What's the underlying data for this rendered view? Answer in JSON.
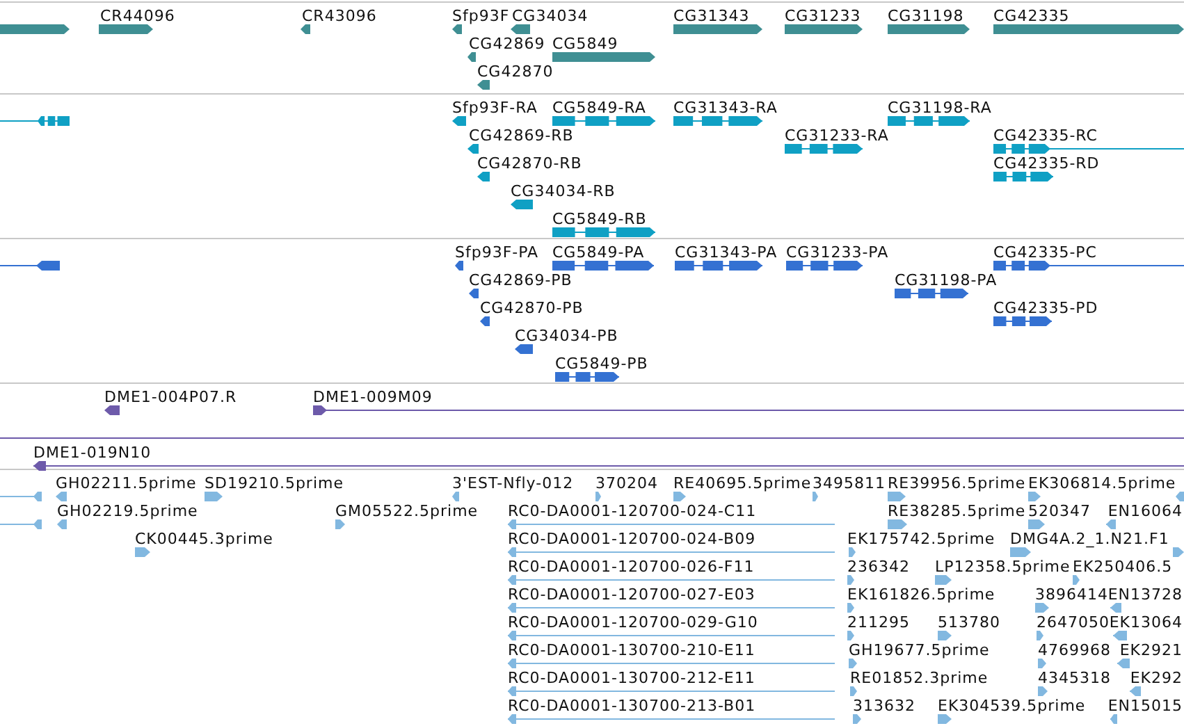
{
  "tracks": [
    {
      "kind": "gene",
      "color": "#3f8f93",
      "features": [
        {
          "reverse": false
        },
        {
          "label": "CR44096",
          "reverse": false
        },
        {
          "label": "CR43096",
          "reverse": true
        },
        {
          "label": "Sfp93F",
          "reverse": true
        },
        {
          "label": "CG34034",
          "reverse": true
        },
        {
          "label": "CG31343",
          "reverse": false
        },
        {
          "label": "CG31233",
          "reverse": false
        },
        {
          "label": "CG31198",
          "reverse": false
        },
        {
          "label": "CG42335",
          "reverse": false
        },
        {
          "label": "CG42869",
          "reverse": true
        },
        {
          "label": "CG5849",
          "reverse": false
        },
        {
          "label": "CG42870",
          "reverse": true
        }
      ]
    },
    {
      "kind": "transcript",
      "color": "#0fa0c4",
      "features": [
        {
          "reverse": true
        },
        {
          "label": "Sfp93F-RA",
          "reverse": true
        },
        {
          "label": "CG5849-RA",
          "reverse": false
        },
        {
          "label": "CG31343-RA",
          "reverse": false
        },
        {
          "label": "CG31198-RA",
          "reverse": false
        },
        {
          "label": "CG42869-RB",
          "reverse": true
        },
        {
          "label": "CG31233-RA",
          "reverse": false
        },
        {
          "label": "CG42335-RC",
          "reverse": false
        },
        {
          "label": "CG42870-RB",
          "reverse": true
        },
        {
          "label": "CG42335-RD",
          "reverse": false
        },
        {
          "label": "CG34034-RB",
          "reverse": true
        },
        {
          "label": "CG5849-RB",
          "reverse": false
        }
      ]
    },
    {
      "kind": "transcript",
      "color": "#3471d2",
      "features": [
        {
          "reverse": true
        },
        {
          "label": "Sfp93F-PA",
          "reverse": true
        },
        {
          "label": "CG5849-PA",
          "reverse": false
        },
        {
          "label": "CG31343-PA",
          "reverse": false
        },
        {
          "label": "CG31233-PA",
          "reverse": false
        },
        {
          "label": "CG42335-PC",
          "reverse": false
        },
        {
          "label": "CG42869-PB",
          "reverse": true
        },
        {
          "label": "CG31198-PA",
          "reverse": false
        },
        {
          "label": "CG42870-PB",
          "reverse": true
        },
        {
          "label": "CG42335-PD",
          "reverse": false
        },
        {
          "label": "CG34034-PB",
          "reverse": true
        },
        {
          "label": "CG5849-PB",
          "reverse": false
        }
      ]
    },
    {
      "kind": "clone",
      "color": "#6d5aaa",
      "features": [
        {
          "kind": "arrow",
          "label": "DME1-004P07.R",
          "reverse": true
        },
        {
          "kind": "arrow",
          "label": "DME1-009M09",
          "reverse": false
        },
        {
          "kind": "line"
        },
        {
          "kind": "arrow",
          "label": "DME1-019N10",
          "reverse": true
        }
      ]
    },
    {
      "kind": "est",
      "color": "#82b8e0",
      "features": [
        {
          "reverse": true
        },
        {
          "label": "GH02211.5prime",
          "reverse": true
        },
        {
          "label": "SD19210.5prime",
          "reverse": false
        },
        {
          "label": "3'EST-Nfly-012",
          "reverse": true
        },
        {
          "label": "370204",
          "reverse": false
        },
        {
          "label": "RE40695.5prime",
          "reverse": false
        },
        {
          "label": "3495811",
          "reverse": false
        },
        {
          "label": "RE39956.5prime",
          "reverse": false
        },
        {
          "label": "EK306814.5prime",
          "reverse": false
        },
        {
          "reverse": true
        },
        {
          "reverse": true
        },
        {
          "label": "GH02219.5prime",
          "reverse": true
        },
        {
          "label": "GM05522.5prime",
          "reverse": false
        },
        {
          "label": "RC0-DA0001-120700-024-C11",
          "reverse": true
        },
        {
          "label": "RE38285.5prime",
          "reverse": false
        },
        {
          "label": "520347",
          "reverse": false
        },
        {
          "label": "EN16064",
          "reverse": true
        },
        {
          "label": "CK00445.3prime",
          "reverse": false
        },
        {
          "label": "RC0-DA0001-120700-024-B09",
          "reverse": true
        },
        {
          "label": "EK175742.5prime",
          "reverse": false
        },
        {
          "label": "DMG4A.2_1.N21.F1",
          "reverse": false
        },
        {
          "reverse": false
        },
        {
          "label": "RC0-DA0001-120700-026-F11",
          "reverse": true
        },
        {
          "label": "236342",
          "reverse": false
        },
        {
          "label": "LP12358.5prime",
          "reverse": false
        },
        {
          "label": "EK250406.5",
          "reverse": false
        },
        {
          "label": "RC0-DA0001-120700-027-E03",
          "reverse": true
        },
        {
          "label": "EK161826.5prime",
          "reverse": false
        },
        {
          "label": "3896414",
          "reverse": false
        },
        {
          "label": "EN13728",
          "reverse": true
        },
        {
          "label": "RC0-DA0001-120700-029-G10",
          "reverse": true
        },
        {
          "label": "211295",
          "reverse": false
        },
        {
          "label": "513780",
          "reverse": false
        },
        {
          "label": "2647050",
          "reverse": false
        },
        {
          "label": "EK13064",
          "reverse": true
        },
        {
          "label": "RC0-DA0001-130700-210-E11",
          "reverse": true
        },
        {
          "label": "GH19677.5prime",
          "reverse": false
        },
        {
          "label": "4769968",
          "reverse": false
        },
        {
          "label": "EK2921",
          "reverse": true
        },
        {
          "label": "RC0-DA0001-130700-212-E11",
          "reverse": true
        },
        {
          "label": "RE01852.3prime",
          "reverse": false
        },
        {
          "label": "4345318",
          "reverse": false
        },
        {
          "label": "EK292",
          "reverse": true
        },
        {
          "label": "RC0-DA0001-130700-213-B01",
          "reverse": true
        },
        {
          "label": "313632",
          "reverse": false
        },
        {
          "label": "EK304539.5prime",
          "reverse": false
        },
        {
          "label": "EN15015",
          "reverse": true
        }
      ]
    }
  ]
}
